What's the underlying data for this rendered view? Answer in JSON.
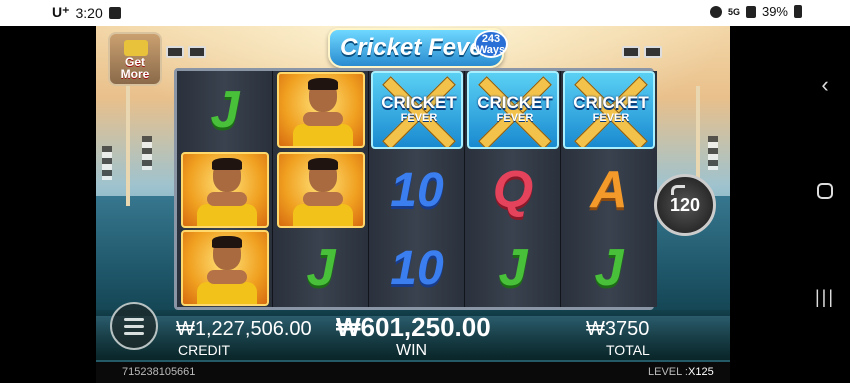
{
  "status_bar": {
    "carrier": "U⁺",
    "time": "3:20",
    "network": "5G",
    "battery": "39%"
  },
  "game": {
    "title": "Cricket Fever",
    "ways_badge": "243 Ways",
    "get_more_label": "Get More",
    "spin_count": "120",
    "reels": [
      [
        "J",
        "player",
        "player"
      ],
      [
        "player",
        "player",
        "J"
      ],
      [
        "wild",
        "10",
        "10"
      ],
      [
        "wild",
        "Q",
        "J"
      ],
      [
        "wild",
        "A",
        "J"
      ]
    ],
    "wild_text_top": "CRICKET",
    "wild_text_bottom": "FEVER"
  },
  "bottom_bar": {
    "credit_value": "₩1,227,506.00",
    "credit_label": "CREDIT",
    "win_value": "₩601,250.00",
    "win_label": "WIN",
    "total_value": "₩3750",
    "total_label": "TOTAL"
  },
  "footer": {
    "session_id": "715238105661",
    "level_label": "LEVEL :",
    "level_value": "X125"
  },
  "nav": {
    "back_icon": "chevron-left-icon",
    "home_icon": "circle-home-icon",
    "recents_icon": "recents-icon"
  }
}
